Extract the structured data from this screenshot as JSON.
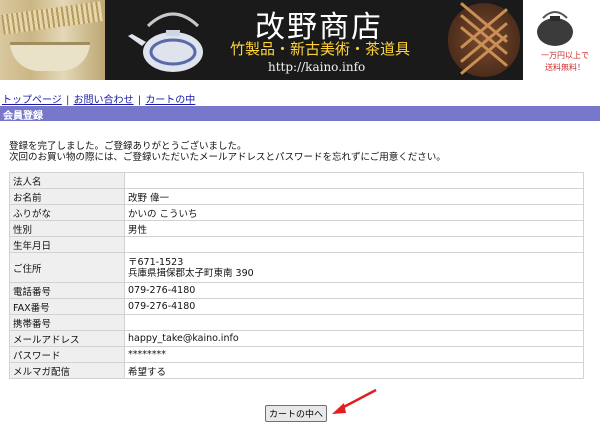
{
  "banner": {
    "title": "改野商店",
    "subtitle": "竹製品・新古美術・茶道具",
    "url": "http://kaino.info",
    "side_note_1": "一万円以上で",
    "side_note_2": "送料無料！"
  },
  "nav": {
    "items": [
      {
        "label": "トップページ"
      },
      {
        "label": "お問い合わせ"
      },
      {
        "label": "カートの中"
      }
    ],
    "separator": "|"
  },
  "section": {
    "title": "会員登録"
  },
  "message": {
    "line1": "登録を完了しました。ご登録ありがとうございました。",
    "line2": "次回のお買い物の際には、ご登録いただいたメールアドレスとパスワードを忘れずにご用意ください。"
  },
  "form": {
    "rows": [
      {
        "label": "法人名",
        "value": ""
      },
      {
        "label": "お名前",
        "value": "改野 偉一"
      },
      {
        "label": "ふりがな",
        "value": "かいの こういち"
      },
      {
        "label": "性別",
        "value": "男性"
      },
      {
        "label": "生年月日",
        "value": ""
      },
      {
        "label": "ご住所",
        "value_line1": "〒671-1523",
        "value_line2": "兵庫県揖保郡太子町東南 390"
      },
      {
        "label": "電話番号",
        "value": "079-276-4180"
      },
      {
        "label": "FAX番号",
        "value": "079-276-4180"
      },
      {
        "label": "携帯番号",
        "value": ""
      },
      {
        "label": "メールアドレス",
        "value": "happy_take@kaino.info"
      },
      {
        "label": "パスワード",
        "value": "********"
      },
      {
        "label": "メルマガ配信",
        "value": "希望する"
      }
    ]
  },
  "buttons": {
    "cart_label": "カートの中へ"
  },
  "colors": {
    "section_bar": "#7777cc",
    "link": "#1a1aa6",
    "arrow": "#e02020",
    "banner_bg": "#1a1a1a",
    "subtitle": "#ffd43a"
  }
}
